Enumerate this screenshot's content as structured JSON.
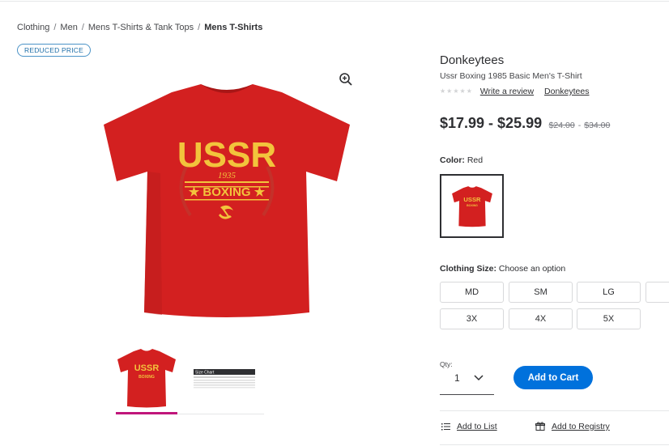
{
  "breadcrumb": {
    "items": [
      "Clothing",
      "Men",
      "Mens T-Shirts & Tank Tops",
      "Mens T-Shirts"
    ],
    "separator": "/"
  },
  "badge": "REDUCED PRICE",
  "product": {
    "brand": "Donkeytees",
    "title": "Ussr Boxing 1985 Basic Men's T-Shirt",
    "rating_stars": "★★★★★",
    "write_review": "Write a review",
    "brand_link": "Donkeytees",
    "shirt_print": {
      "top": "USSR",
      "year": "1935",
      "banner": "★ BOXING ★"
    },
    "thumb_print": {
      "top": "USSR",
      "banner": "BOXING"
    }
  },
  "price": {
    "range": "$17.99 - $25.99",
    "old_low": "$24.00",
    "dash": "-",
    "old_high": "$34.00"
  },
  "color": {
    "label": "Color:",
    "value": "Red",
    "hex": "#d32020"
  },
  "size": {
    "label": "Clothing Size:",
    "placeholder": "Choose an option",
    "options": [
      "MD",
      "SM",
      "LG",
      "3X",
      "4X",
      "5X"
    ]
  },
  "qty": {
    "label": "Qty:",
    "value": "1"
  },
  "add_to_cart": "Add to Cart",
  "actions": {
    "list": "Add to List",
    "registry": "Add to Registry"
  },
  "size_chart_thumb": {
    "title": "Size Chart"
  },
  "colors": {
    "accent": "#0071dc",
    "badge": "#4b93c7",
    "thumb_underline": "#c0167b",
    "shirt": "#d32020",
    "print": "#f2c43c"
  },
  "icons": [
    "zoom-in-icon",
    "chevron-down-icon",
    "list-icon",
    "gift-icon"
  ]
}
